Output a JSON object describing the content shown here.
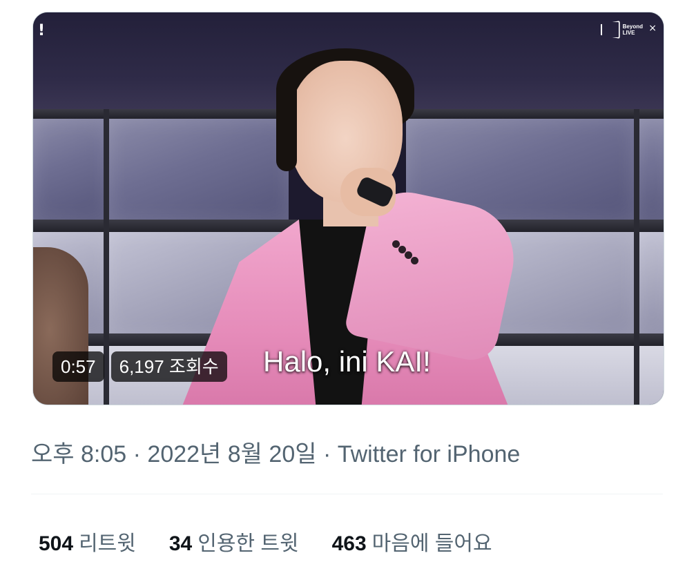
{
  "video": {
    "duration": "0:57",
    "views": "6,197 조회수",
    "caption": "Halo, ini KAI!",
    "brand_line1": "Beyond",
    "brand_line2": "LIVE",
    "alert_icon": "!",
    "close_icon": "×"
  },
  "tweet_meta": {
    "time": "오후 8:05",
    "separator": " · ",
    "date": "2022년 8월 20일",
    "source": "Twitter for iPhone"
  },
  "stats": [
    {
      "count": "504",
      "label": "리트윗"
    },
    {
      "count": "34",
      "label": "인용한 트윗"
    },
    {
      "count": "463",
      "label": "마음에 들어요"
    }
  ],
  "colors": {
    "secondary_text": "#536471",
    "primary_text": "#0f1419",
    "jacket_pink": "#e58bb9"
  }
}
